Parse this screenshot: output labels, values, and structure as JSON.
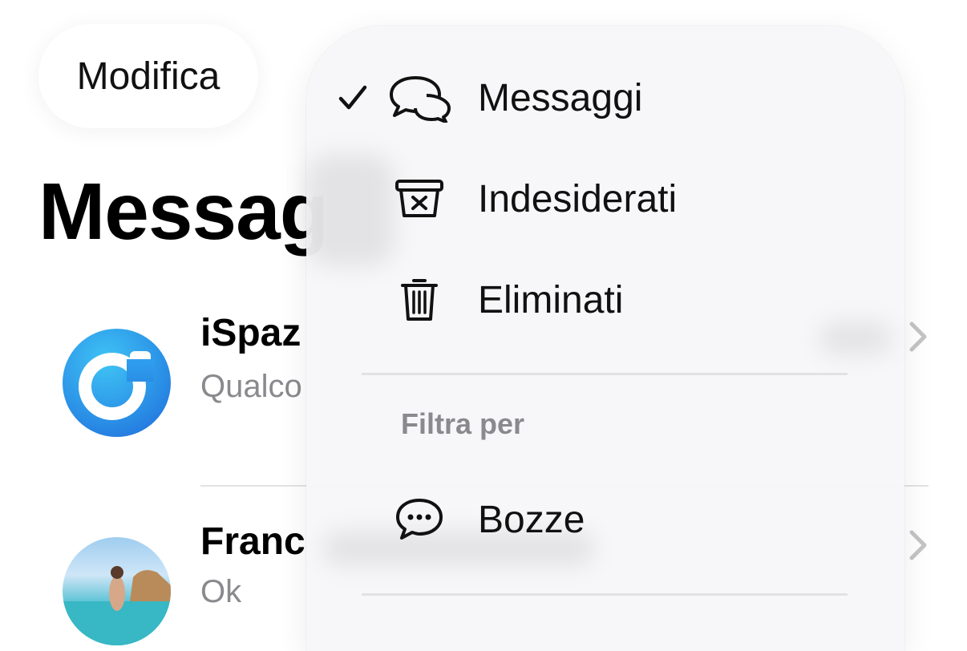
{
  "header": {
    "edit_label": "Modifica",
    "title": "Messaggi",
    "title_visible": "Messag"
  },
  "list": {
    "rows": [
      {
        "name": "iSpaz",
        "preview": "Qualco"
      },
      {
        "name": "Franc",
        "preview": "Ok"
      }
    ]
  },
  "menu": {
    "items": [
      {
        "label": "Messaggi",
        "icon": "chat-bubbles-icon",
        "checked": true
      },
      {
        "label": "Indesiderati",
        "icon": "junk-bin-icon",
        "checked": false
      },
      {
        "label": "Eliminati",
        "icon": "trash-icon",
        "checked": false
      }
    ],
    "filter_header": "Filtra per",
    "filters": [
      {
        "label": "Bozze",
        "icon": "draft-bubble-icon"
      }
    ]
  },
  "colors": {
    "accent": "#2a8fe6",
    "secondary_text": "#8a8a8e",
    "menu_bg": "#f7f7f9"
  }
}
